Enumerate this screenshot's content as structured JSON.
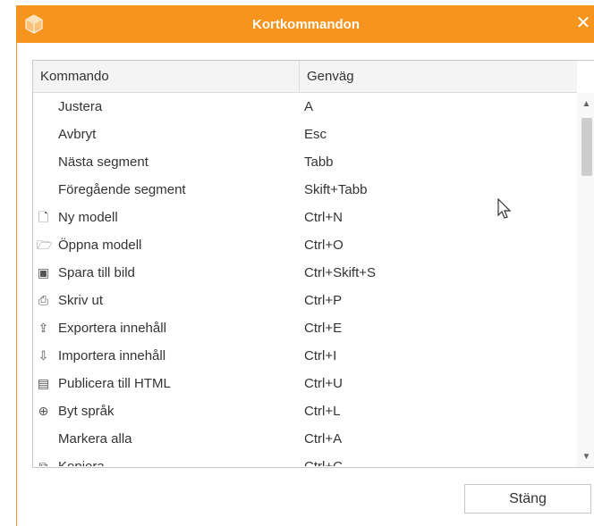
{
  "window": {
    "title": "Kortkommandon",
    "close_glyph": "✕"
  },
  "table": {
    "headers": {
      "command": "Kommando",
      "shortcut": "Genväg"
    },
    "rows": [
      {
        "command": "Justera",
        "shortcut": "A",
        "icon": ""
      },
      {
        "command": "Avbryt",
        "shortcut": "Esc",
        "icon": ""
      },
      {
        "command": "Nästa segment",
        "shortcut": "Tabb",
        "icon": ""
      },
      {
        "command": "Föregående segment",
        "shortcut": "Skift+Tabb",
        "icon": ""
      },
      {
        "command": "Ny modell",
        "shortcut": "Ctrl+N",
        "icon": "new-model-icon"
      },
      {
        "command": "Öppna modell",
        "shortcut": "Ctrl+O",
        "icon": "open-model-icon"
      },
      {
        "command": "Spara till bild",
        "shortcut": "Ctrl+Skift+S",
        "icon": "save-image-icon"
      },
      {
        "command": "Skriv ut",
        "shortcut": "Ctrl+P",
        "icon": "printer-icon"
      },
      {
        "command": "Exportera innehåll",
        "shortcut": "Ctrl+E",
        "icon": "export-icon"
      },
      {
        "command": "Importera innehåll",
        "shortcut": "Ctrl+I",
        "icon": "import-icon"
      },
      {
        "command": "Publicera till HTML",
        "shortcut": "Ctrl+U",
        "icon": "publish-html-icon"
      },
      {
        "command": "Byt språk",
        "shortcut": "Ctrl+L",
        "icon": "globe-icon"
      },
      {
        "command": "Markera alla",
        "shortcut": "Ctrl+A",
        "icon": ""
      },
      {
        "command": "Kopiera",
        "shortcut": "Ctrl+C",
        "icon": "copy-icon"
      }
    ]
  },
  "footer": {
    "close_label": "Stäng"
  },
  "colors": {
    "titlebar": "#f7941d",
    "title_text": "#ffffff",
    "text": "#333333",
    "border": "#c8c8c8"
  }
}
